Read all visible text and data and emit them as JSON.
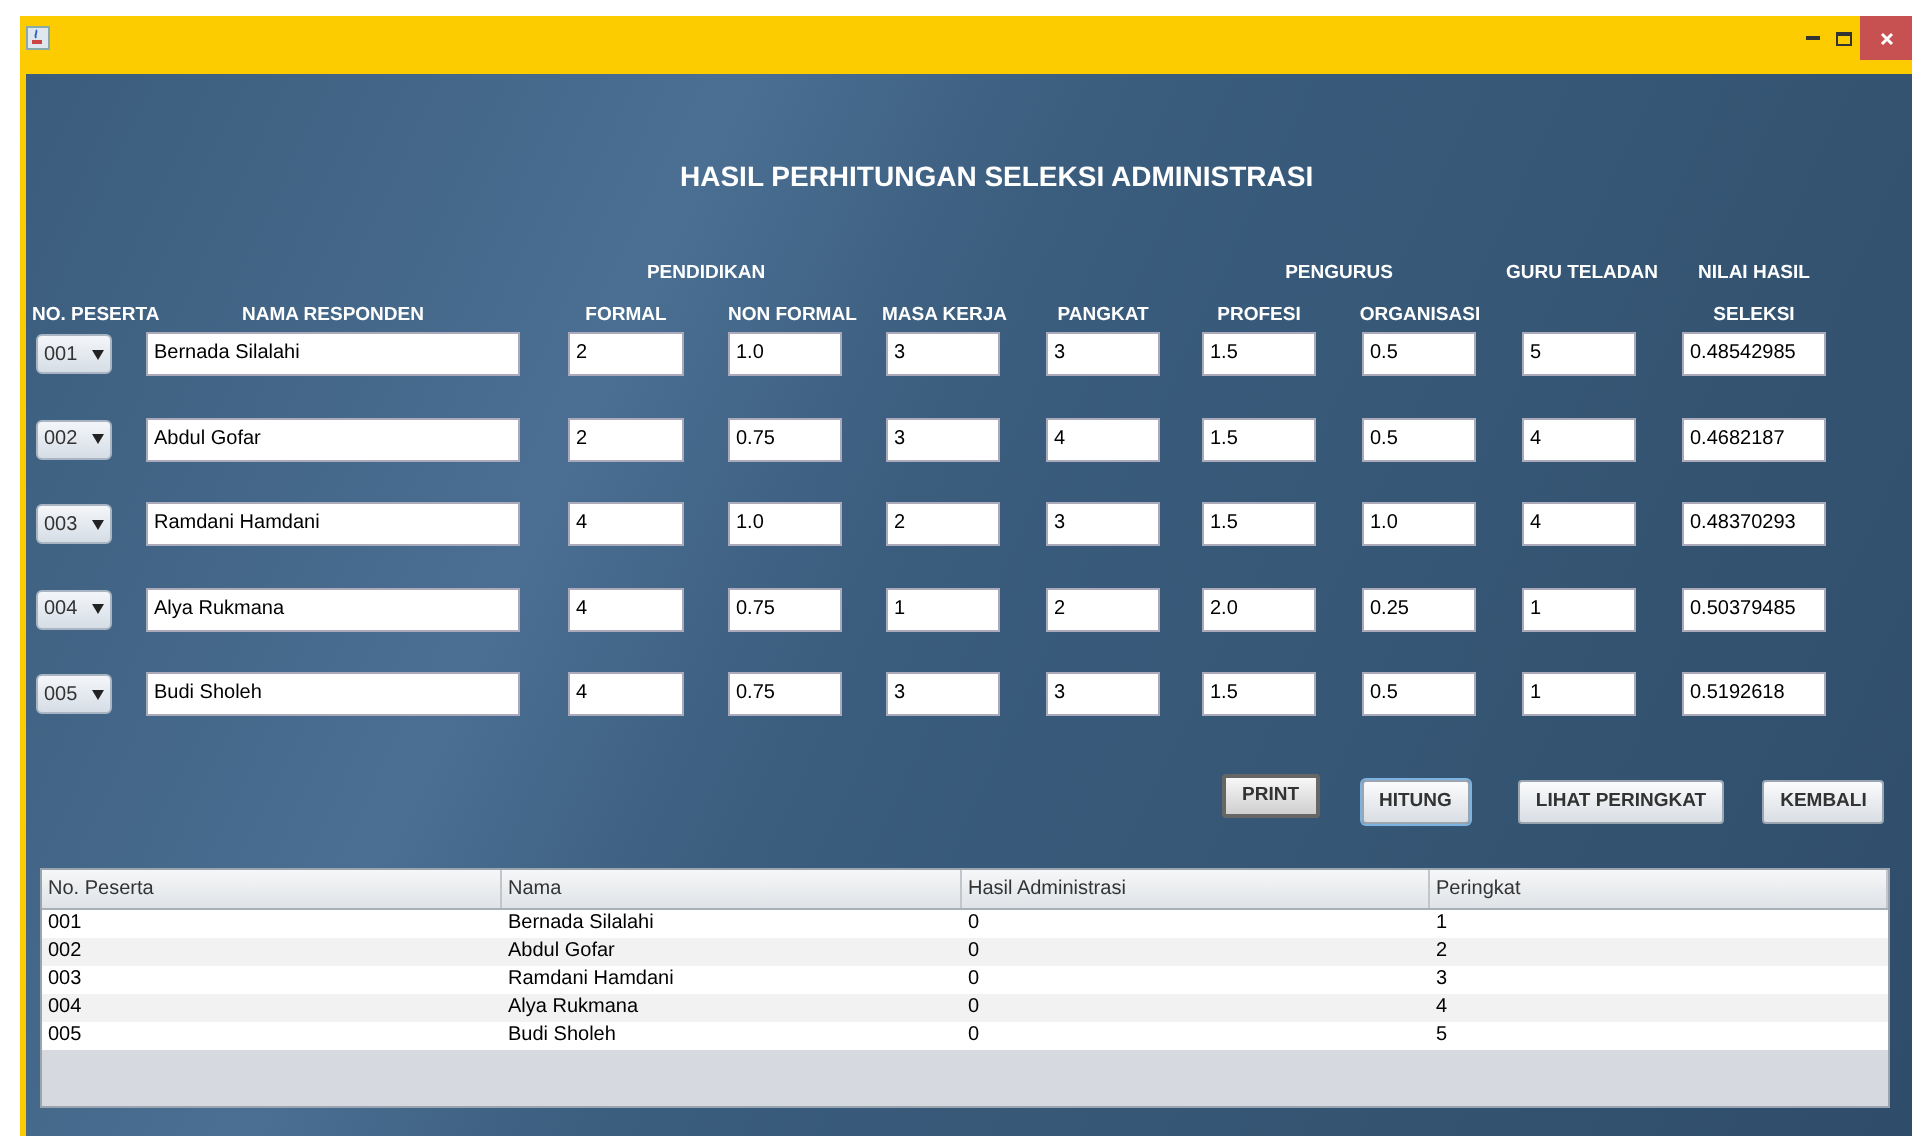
{
  "title": "HASIL PERHITUNGAN SELEKSI ADMINISTRASI",
  "headers_top": [
    "PENDIDIKAN",
    "PENGURUS",
    "GURU TELADAN",
    "NILAI HASIL"
  ],
  "headers": [
    "NO. PESERTA",
    "NAMA RESPONDEN",
    "FORMAL",
    "NON FORMAL",
    "MASA KERJA",
    "PANGKAT",
    "PROFESI",
    "ORGANISASI",
    "SELEKSI"
  ],
  "rows": [
    {
      "no": "001",
      "name": "Bernada Silalahi",
      "values": [
        "2",
        "1.0",
        "3",
        "3",
        "1.5",
        "0.5",
        "5",
        "0.48542985"
      ]
    },
    {
      "no": "002",
      "name": "Abdul Gofar",
      "values": [
        "2",
        "0.75",
        "3",
        "4",
        "1.5",
        "0.5",
        "4",
        "0.4682187"
      ]
    },
    {
      "no": "003",
      "name": "Ramdani Hamdani",
      "values": [
        "4",
        "1.0",
        "2",
        "3",
        "1.5",
        "1.0",
        "4",
        "0.48370293"
      ]
    },
    {
      "no": "004",
      "name": "Alya Rukmana",
      "values": [
        "4",
        "0.75",
        "1",
        "2",
        "2.0",
        "0.25",
        "1",
        "0.50379485"
      ]
    },
    {
      "no": "005",
      "name": "Budi Sholeh",
      "values": [
        "4",
        "0.75",
        "3",
        "3",
        "1.5",
        "0.5",
        "1",
        "0.5192618"
      ]
    }
  ],
  "buttons": [
    {
      "label": "PRINT",
      "pressed": true,
      "focused": false
    },
    {
      "label": "HITUNG",
      "pressed": false,
      "focused": true
    },
    {
      "label": "LIHAT PERINGKAT",
      "pressed": false,
      "focused": false
    },
    {
      "label": "KEMBALI",
      "pressed": false,
      "focused": false
    }
  ],
  "table": {
    "columns": [
      "No. Peserta",
      "Nama",
      "Hasil Administrasi",
      "Peringkat"
    ],
    "rows": [
      [
        "001",
        "Bernada Silalahi",
        "0",
        "1"
      ],
      [
        "002",
        "Abdul Gofar",
        "0",
        "2"
      ],
      [
        "003",
        "Ramdani Hamdani",
        "0",
        "3"
      ],
      [
        "004",
        "Alya Rukmana",
        "0",
        "4"
      ],
      [
        "005",
        "Budi Sholeh",
        "0",
        "5"
      ]
    ]
  }
}
